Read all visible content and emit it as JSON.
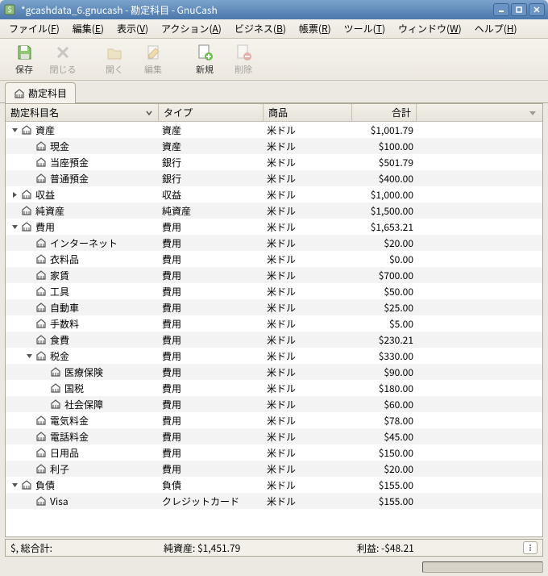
{
  "window": {
    "title": "*gcashdata_6.gnucash - 勘定科目 - GnuCash"
  },
  "menubar": {
    "file": {
      "label": "ファイル",
      "key": "F"
    },
    "edit": {
      "label": "編集",
      "key": "E"
    },
    "view": {
      "label": "表示",
      "key": "V"
    },
    "actions": {
      "label": "アクション",
      "key": "A"
    },
    "business": {
      "label": "ビジネス",
      "key": "B"
    },
    "reports": {
      "label": "帳票",
      "key": "R"
    },
    "tools": {
      "label": "ツール",
      "key": "T"
    },
    "windows": {
      "label": "ウィンドウ",
      "key": "W"
    },
    "help": {
      "label": "ヘルプ",
      "key": "H"
    }
  },
  "toolbar": {
    "save": "保存",
    "close": "閉じる",
    "open": "開く",
    "edit": "編集",
    "new": "新規",
    "delete": "削除"
  },
  "tab": {
    "label": "勘定科目"
  },
  "columns": {
    "name": "勘定科目名",
    "type": "タイプ",
    "commodity": "商品",
    "total": "合計"
  },
  "rows": [
    {
      "indent": 0,
      "expander": "down",
      "name": "資産",
      "type": "資産",
      "commodity": "米ドル",
      "total": "$1,001.79"
    },
    {
      "indent": 1,
      "expander": "none",
      "name": "現金",
      "type": "資産",
      "commodity": "米ドル",
      "total": "$100.00"
    },
    {
      "indent": 1,
      "expander": "none",
      "name": "当座預金",
      "type": "銀行",
      "commodity": "米ドル",
      "total": "$501.79"
    },
    {
      "indent": 1,
      "expander": "none",
      "name": "普通預金",
      "type": "銀行",
      "commodity": "米ドル",
      "total": "$400.00"
    },
    {
      "indent": 0,
      "expander": "right",
      "name": "収益",
      "type": "収益",
      "commodity": "米ドル",
      "total": "$1,000.00"
    },
    {
      "indent": 0,
      "expander": "none",
      "name": "純資産",
      "type": "純資産",
      "commodity": "米ドル",
      "total": "$1,500.00"
    },
    {
      "indent": 0,
      "expander": "down",
      "name": "費用",
      "type": "費用",
      "commodity": "米ドル",
      "total": "$1,653.21"
    },
    {
      "indent": 1,
      "expander": "none",
      "name": "インターネット",
      "type": "費用",
      "commodity": "米ドル",
      "total": "$20.00"
    },
    {
      "indent": 1,
      "expander": "none",
      "name": "衣料品",
      "type": "費用",
      "commodity": "米ドル",
      "total": "$0.00"
    },
    {
      "indent": 1,
      "expander": "none",
      "name": "家賃",
      "type": "費用",
      "commodity": "米ドル",
      "total": "$700.00"
    },
    {
      "indent": 1,
      "expander": "none",
      "name": "工具",
      "type": "費用",
      "commodity": "米ドル",
      "total": "$50.00"
    },
    {
      "indent": 1,
      "expander": "none",
      "name": "自動車",
      "type": "費用",
      "commodity": "米ドル",
      "total": "$25.00"
    },
    {
      "indent": 1,
      "expander": "none",
      "name": "手数料",
      "type": "費用",
      "commodity": "米ドル",
      "total": "$5.00"
    },
    {
      "indent": 1,
      "expander": "none",
      "name": "食費",
      "type": "費用",
      "commodity": "米ドル",
      "total": "$230.21"
    },
    {
      "indent": 1,
      "expander": "down",
      "name": "税金",
      "type": "費用",
      "commodity": "米ドル",
      "total": "$330.00"
    },
    {
      "indent": 2,
      "expander": "none",
      "name": "医療保険",
      "type": "費用",
      "commodity": "米ドル",
      "total": "$90.00"
    },
    {
      "indent": 2,
      "expander": "none",
      "name": "国税",
      "type": "費用",
      "commodity": "米ドル",
      "total": "$180.00"
    },
    {
      "indent": 2,
      "expander": "none",
      "name": "社会保障",
      "type": "費用",
      "commodity": "米ドル",
      "total": "$60.00"
    },
    {
      "indent": 1,
      "expander": "none",
      "name": "電気料金",
      "type": "費用",
      "commodity": "米ドル",
      "total": "$78.00"
    },
    {
      "indent": 1,
      "expander": "none",
      "name": "電話料金",
      "type": "費用",
      "commodity": "米ドル",
      "total": "$45.00"
    },
    {
      "indent": 1,
      "expander": "none",
      "name": "日用品",
      "type": "費用",
      "commodity": "米ドル",
      "total": "$150.00"
    },
    {
      "indent": 1,
      "expander": "none",
      "name": "利子",
      "type": "費用",
      "commodity": "米ドル",
      "total": "$20.00"
    },
    {
      "indent": 0,
      "expander": "down",
      "name": "負債",
      "type": "負債",
      "commodity": "米ドル",
      "total": "$155.00"
    },
    {
      "indent": 1,
      "expander": "none",
      "name": "Visa",
      "type": "クレジットカード",
      "commodity": "米ドル",
      "total": "$155.00"
    }
  ],
  "summary": {
    "label": "$, 総合計:",
    "net_assets": "純資産: $1,451.79",
    "profit": "利益: -$48.21"
  }
}
